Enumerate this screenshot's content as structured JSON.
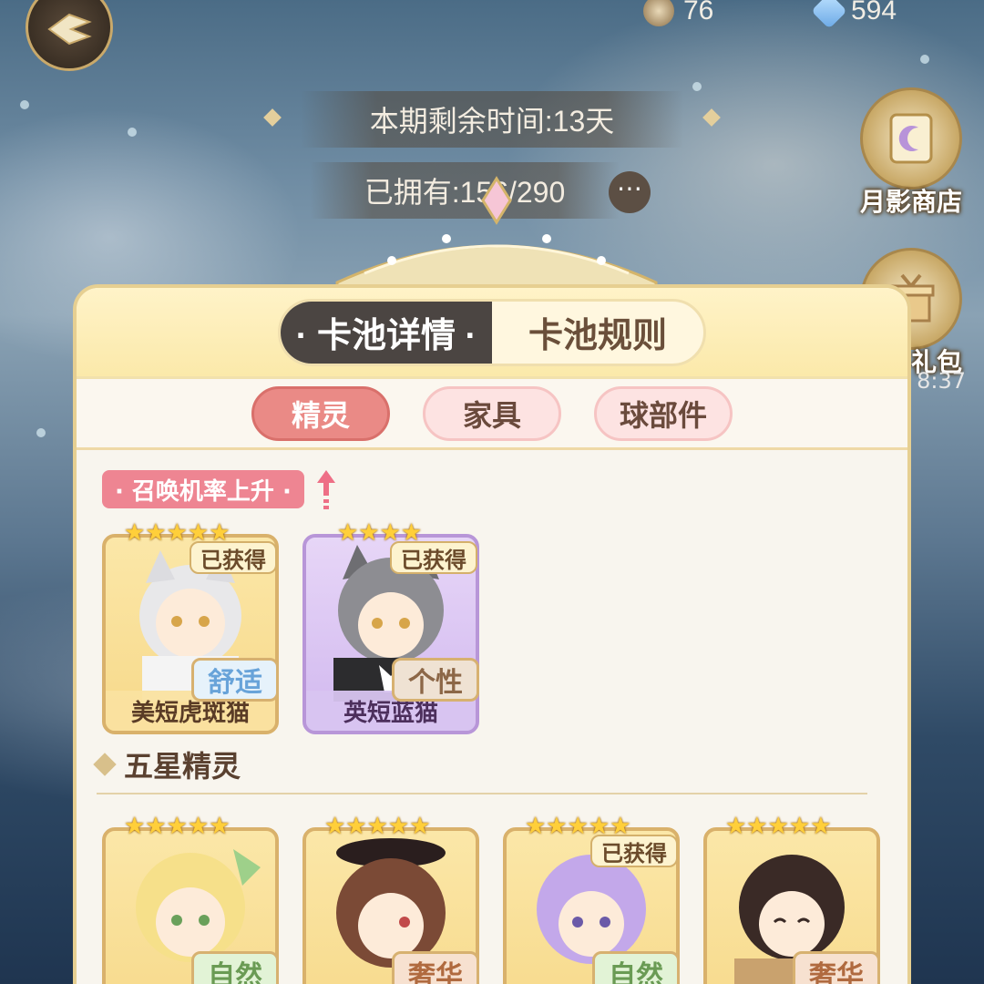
{
  "currencies": [
    {
      "icon": "moon-coin-icon",
      "value": "76"
    },
    {
      "icon": "crystal-gem-icon",
      "value": "594"
    }
  ],
  "banner": {
    "remaining_time": "本期剩余时间:13天",
    "owned_count": "已拥有:156/290"
  },
  "side_buttons": {
    "moon_shop": "月影商店",
    "gift_pack": "礼包",
    "gift_timer": "8:37"
  },
  "panel": {
    "main_tabs": [
      "· 卡池详情 ·",
      "卡池规则"
    ],
    "active_main_tab": 0,
    "sub_tabs": [
      "精灵",
      "家具",
      "球部件"
    ],
    "active_sub_tab": 0,
    "rate_up_label": "· 召唤机率上升 ·",
    "five_star_section": "五星精灵"
  },
  "rate_up_cards": [
    {
      "name": "美短虎斑猫",
      "stars": "★★★★★",
      "owned_label": "已获得",
      "trait": "舒适",
      "style": "gold"
    },
    {
      "name": "英短蓝猫",
      "stars": "★★★★",
      "owned_label": "已获得",
      "trait": "个性",
      "style": "purple"
    }
  ],
  "five_star_cards": [
    {
      "stars": "★★★★★",
      "trait": "自然"
    },
    {
      "stars": "★★★★★",
      "trait": "奢华"
    },
    {
      "stars": "★★★★★",
      "trait": "自然",
      "owned_label": "已获得"
    },
    {
      "stars": "★★★★★",
      "trait": "奢华"
    }
  ]
}
